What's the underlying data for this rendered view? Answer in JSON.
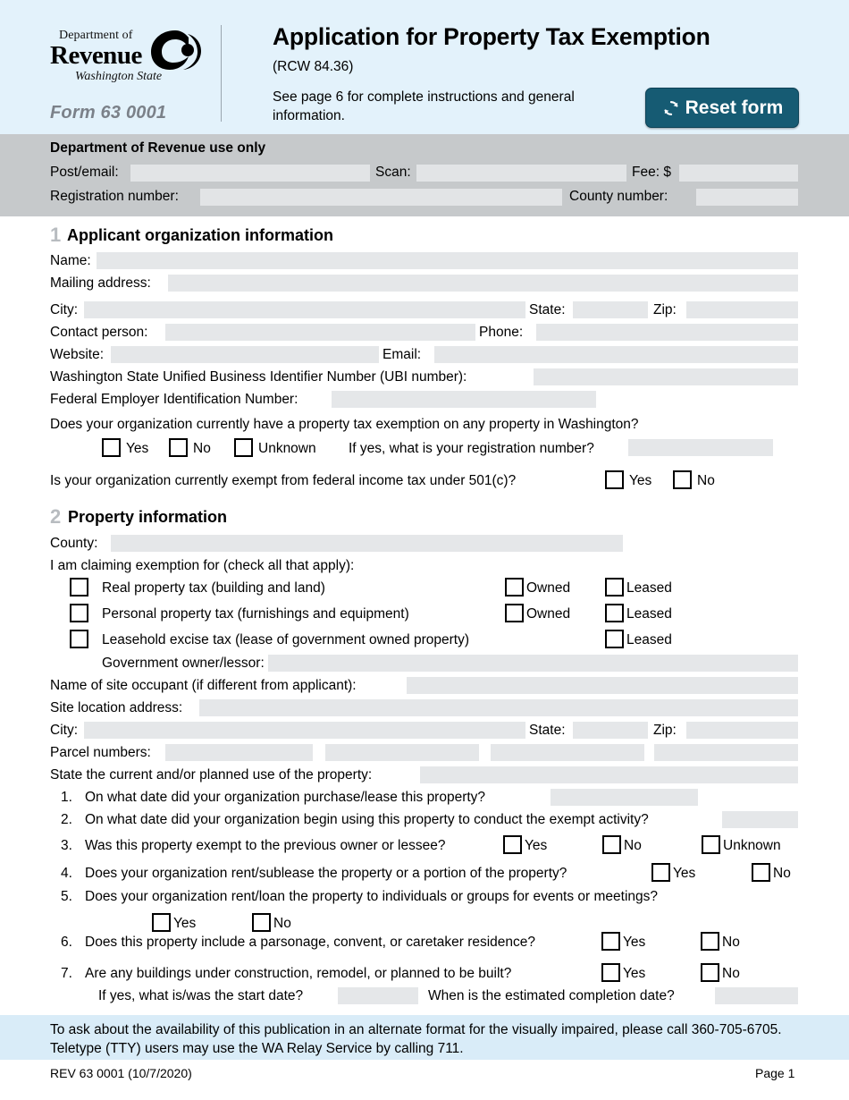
{
  "header": {
    "logo": {
      "department_line": "Department of",
      "revenue_line": "Revenue",
      "state_line": "Washington State"
    },
    "form_number": "Form 63 0001",
    "title": "Application for Property Tax Exemption",
    "rcw": "(RCW 84.36)",
    "instructions": "See page 6 for complete instructions and general information.",
    "reset_button": "Reset form",
    "accent_color": "#165b73",
    "band_color": "#e3f2fb"
  },
  "dor_use_only": {
    "title": "Department of Revenue use only",
    "band_color": "#c6c9cb",
    "fields": [
      {
        "label": "Post/email:",
        "value": ""
      },
      {
        "label": "Scan:",
        "value": ""
      },
      {
        "label": "Fee: $",
        "value": ""
      },
      {
        "label": "Registration number:",
        "value": ""
      },
      {
        "label": "County number:",
        "value": ""
      }
    ]
  },
  "section1": {
    "number": "1",
    "title": "Applicant organization information",
    "name_label": "Name:",
    "name_value": "",
    "mailing_label": "Mailing address:",
    "mailing_value": "",
    "city_label": "City:",
    "city_value": "",
    "state_label": "State:",
    "state_value": "",
    "zip_label": "Zip:",
    "zip_value": "",
    "contact_label": "Contact person:",
    "contact_value": "",
    "phone_label": "Phone:",
    "phone_value": "",
    "website_label": "Website:",
    "website_value": "",
    "email_label": "Email:",
    "email_value": "",
    "ubi_label": "Washington State Unified Business Identifier Number (UBI number):",
    "ubi_value": "",
    "fein_label": "Federal Employer Identification Number:",
    "fein_value": "",
    "q_exempt": "Does your organization currently have a property tax exemption on any property in Washington?",
    "q_exempt_yes": "Yes",
    "q_exempt_no": "No",
    "q_exempt_unknown": "Unknown",
    "q_exempt_regnum_label": "If yes, what is your registration number?",
    "q_exempt_regnum_value": "",
    "q_501c": "Is your organization currently exempt from federal income tax under 501(c)?",
    "q_501c_yes": "Yes",
    "q_501c_no": "No"
  },
  "section2": {
    "number": "2",
    "title": "Property information",
    "county_label": "County:",
    "county_value": "",
    "claiming_label": "I am claiming exemption for (check all that apply):",
    "claim_rows": [
      {
        "label": "Real property tax (building and land)",
        "owned": "Owned",
        "leased": "Leased",
        "has_owned": true
      },
      {
        "label": "Personal property tax (furnishings and equipment)",
        "owned": "Owned",
        "leased": "Leased",
        "has_owned": true
      },
      {
        "label": "Leasehold excise tax (lease of government owned property)",
        "owned": "",
        "leased": "Leased",
        "has_owned": false
      }
    ],
    "gov_owner_label": "Government owner/lessor:",
    "gov_owner_value": "",
    "occupant_label": "Name of site occupant (if different from applicant):",
    "occupant_value": "",
    "site_address_label": "Site location address:",
    "site_address_value": "",
    "site_city_label": "City:",
    "site_city_value": "",
    "site_state_label": "State:",
    "site_state_value": "",
    "site_zip_label": "Zip:",
    "site_zip_value": "",
    "parcel_label": "Parcel numbers:",
    "parcel_values": [
      "",
      "",
      "",
      ""
    ],
    "use_label": "State the current and/or planned use of the property:",
    "use_value": "",
    "questions": [
      {
        "num": "1.",
        "text": "On what date did your organization purchase/lease this  property?",
        "answer_value": ""
      },
      {
        "num": "2.",
        "text": "On what date did your organization begin using this property to conduct the exempt activity?",
        "answer_value": ""
      },
      {
        "num": "3.",
        "text": "Was this property exempt to the previous owner or lessee?",
        "yes": "Yes",
        "no": "No",
        "unknown": "Unknown"
      },
      {
        "num": "4.",
        "text": "Does your organization rent/sublease the property or a portion of the property?",
        "yes": "Yes",
        "no": "No"
      },
      {
        "num": "5.",
        "text": "Does your organization rent/loan the property to individuals or groups for events or meetings?",
        "yes": "Yes",
        "no": "No"
      },
      {
        "num": "6.",
        "text": "Does this property include a parsonage, convent, or caretaker residence?",
        "yes": "Yes",
        "no": "No"
      },
      {
        "num": "7.",
        "text": "Are any buildings under construction, remodel, or planned to be built?",
        "yes": "Yes",
        "no": "No",
        "start_label": "If yes, what is/was the start date?",
        "start_value": "",
        "completion_label": "When is the estimated completion date?",
        "completion_value": ""
      }
    ]
  },
  "footer": {
    "accessibility": "To ask about the availability of this publication in an alternate format for the visually impaired, please call 360-705-6705. Teletype (TTY) users may use the WA Relay Service by calling 711.",
    "rev": "REV 63 0001  (10/7/2020)",
    "page": "Page 1",
    "band_color": "#d9ecf8"
  }
}
